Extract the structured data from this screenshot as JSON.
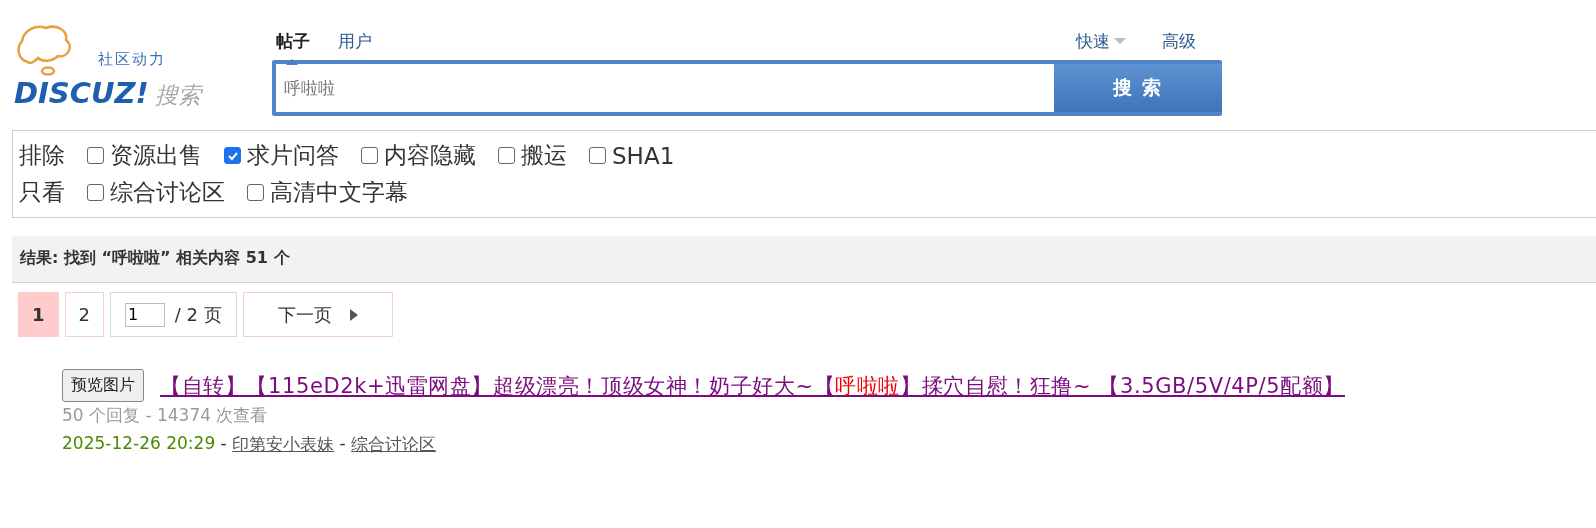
{
  "logo": {
    "tagline": "社区动力",
    "brand": "DISCUZ!",
    "suffix": "搜索"
  },
  "search_tabs": [
    {
      "label": "帖子",
      "selected": true
    },
    {
      "label": "用户",
      "selected": false
    }
  ],
  "search_links": [
    {
      "label": "快速",
      "kind": "dropdown"
    },
    {
      "label": "高级",
      "kind": "link"
    }
  ],
  "search": {
    "value": "呼啦啦",
    "button": "搜 索"
  },
  "filters": [
    {
      "label": "排除",
      "options": [
        {
          "label": "资源出售",
          "checked": false
        },
        {
          "label": "求片问答",
          "checked": true
        },
        {
          "label": "内容隐藏",
          "checked": false
        },
        {
          "label": "搬运",
          "checked": false
        },
        {
          "label": "SHA1",
          "checked": false
        }
      ]
    },
    {
      "label": "只看",
      "options": [
        {
          "label": "综合讨论区",
          "checked": false
        },
        {
          "label": "高清中文字幕",
          "checked": false
        }
      ]
    }
  ],
  "results_summary": "结果: 找到 “呼啦啦” 相关内容 51 个",
  "pagination": {
    "pages": [
      {
        "label": "1",
        "selected": true
      },
      {
        "label": "2",
        "selected": false
      }
    ],
    "page_input": "1",
    "total": " / 2 页",
    "next": "下一页"
  },
  "results": [
    {
      "preview_button": "预览图片",
      "title_parts": [
        {
          "text": "【自转】【115eD2k+迅雷网盘】超级漂亮！顶级女神！奶子好大~【",
          "highlight": false
        },
        {
          "text": "呼啦啦",
          "highlight": true
        },
        {
          "text": "】揉穴自慰！狂撸~ 【3.5GB/5V/4P/5配额】",
          "highlight": false
        }
      ],
      "stats": "50 个回复 - 14374 次查看",
      "date": "2025-12-26 20:29",
      "separator_1": " - ",
      "author": "印第安小表妹",
      "separator_2": " - ",
      "forum": "综合讨论区"
    }
  ]
}
